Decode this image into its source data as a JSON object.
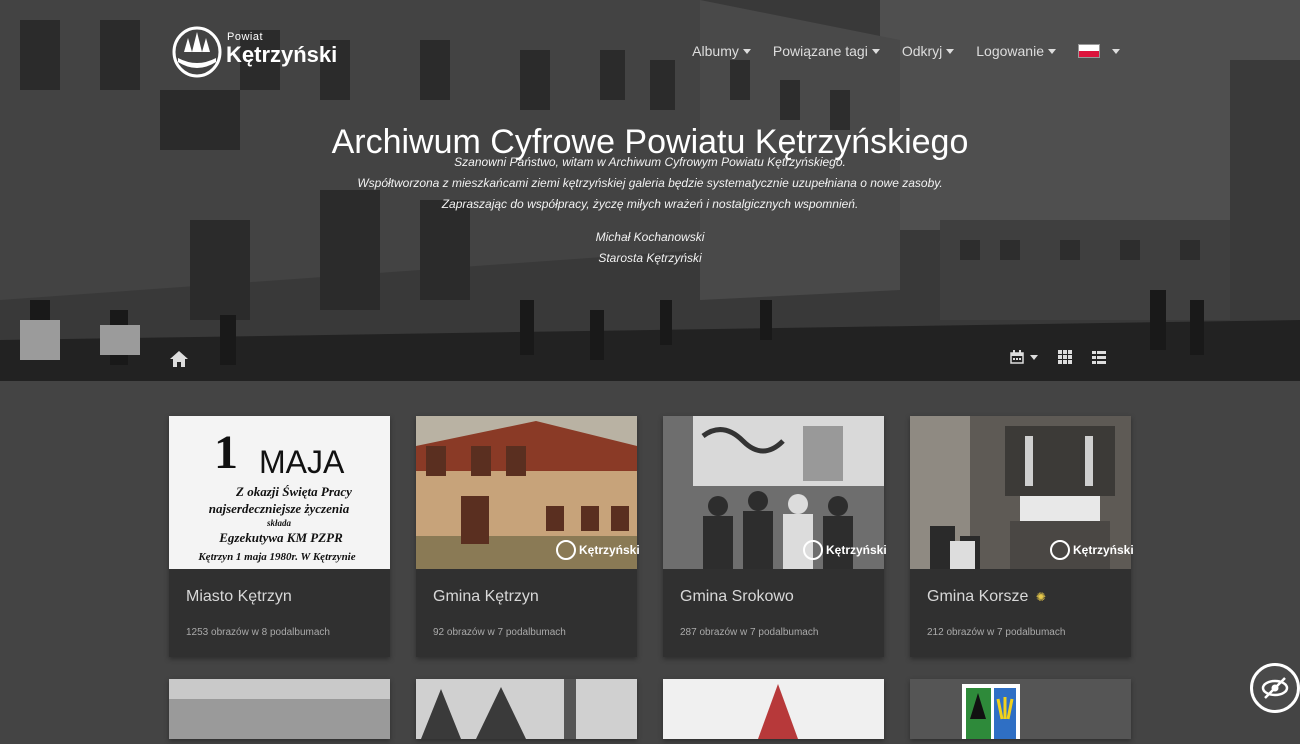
{
  "logo": {
    "line1": "Powiat",
    "line2": "Kętrzyński"
  },
  "nav": {
    "items": [
      {
        "label": "Albumy"
      },
      {
        "label": "Powiązane tagi"
      },
      {
        "label": "Odkryj"
      },
      {
        "label": "Logowanie"
      }
    ],
    "language": "pl"
  },
  "hero": {
    "title": "Archiwum Cyfrowe Powiatu Kętrzyńskiego",
    "lines": [
      "Szanowni Państwo, witam w Archiwum Cyfrowym Powiatu Kętrzyńskiego.",
      "Współtworzona z mieszkańcami ziemi kętrzyńskiej galeria będzie systematycznie uzupełniana o nowe zasoby.",
      "Zapraszając do współpracy, życzę miłych wrażeń i nostalgicznych wspomnień."
    ],
    "signature": [
      "Michał Kochanowski",
      "Starosta Kętrzyński"
    ]
  },
  "toolbar": {
    "icons": [
      "calendar-icon",
      "grid-icon",
      "list-icon"
    ]
  },
  "albums": [
    {
      "title": "Miasto Kętrzyn",
      "subtitle": "1253 obrazów w 8 podalbumach"
    },
    {
      "title": "Gmina Kętrzyn",
      "subtitle": "92 obrazów w 7 podalbumach"
    },
    {
      "title": "Gmina Srokowo",
      "subtitle": "287 obrazów w 7 podalbumach"
    },
    {
      "title": "Gmina Korsze",
      "subtitle": "212 obrazów w 7 podalbumach",
      "badge": "new-icon"
    }
  ],
  "thumb_text": {
    "album1": {
      "big": "1",
      "maja": "MAJA",
      "lines": [
        "Z okazji Święta Pracy",
        "najserdeczniejsze życzenia",
        "składa",
        "Egzekutywa KM PZPR",
        "Kętrzyn 1 maja 1980r. W Kętrzynie"
      ]
    }
  },
  "watermark": "Kętrzyński",
  "colors": {
    "page_bg": "#444444",
    "card_bg": "#303030",
    "flag_red": "#dc143c"
  }
}
